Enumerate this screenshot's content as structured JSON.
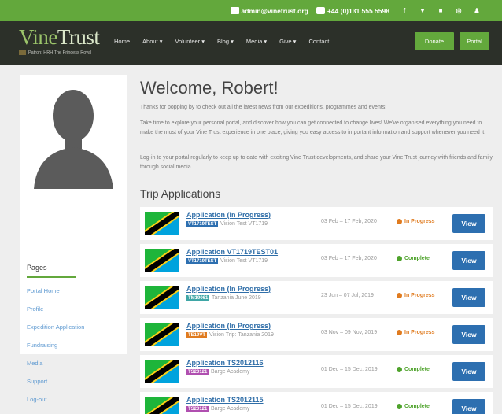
{
  "topbar": {
    "email": "admin@vinetrust.org",
    "phone": "+44 (0)131 555 5598",
    "social": [
      {
        "icon": "facebook-icon",
        "glyph": "f"
      },
      {
        "icon": "twitter-icon",
        "glyph": "▾"
      },
      {
        "icon": "youtube-icon",
        "glyph": "■"
      },
      {
        "icon": "instagram-icon",
        "glyph": "◎"
      },
      {
        "icon": "account-icon",
        "glyph": "♟"
      }
    ]
  },
  "header": {
    "logo": {
      "vine": "Vine",
      "trust": "Trust",
      "patron": "Patron: HRH The Princess Royal"
    },
    "nav": [
      "Home",
      "About ▾",
      "Volunteer ▾",
      "Blog ▾",
      "Media ▾",
      "Give ▾",
      "Contact"
    ],
    "donate_label": "Donate",
    "portal_label": "Portal"
  },
  "sidebar": {
    "heading": "Pages",
    "links": [
      "Portal Home",
      "Profile",
      "Expedition Application",
      "Fundraising",
      "Media",
      "Support",
      "Log-out"
    ]
  },
  "main": {
    "welcome": "Welcome, Robert!",
    "paragraphs": [
      "Thanks for popping by to check out all the latest news from our expeditions, programmes and events!",
      "Take time to explore your personal portal, and discover how you can get connected to change lives! We've organised everything you need to make the most of your Vine Trust experience in one place, giving you easy access to important information and support whenever you need it.",
      "Log-in to your portal regularly to keep up to date with exciting Vine Trust developments, and share your Vine Trust journey with friends and family through social media."
    ],
    "trip_heading": "Trip Applications",
    "view_label": "View",
    "applications": [
      {
        "title": "Application (In Progress)",
        "code": "VT1719TEST",
        "code_color": "#2d6fb0",
        "trip": "Vision Test VT1719",
        "dates": "03 Feb – 17 Feb, 2020",
        "status": "In Progress",
        "status_color": "#e07b1f"
      },
      {
        "title": "Application VT1719TEST01",
        "code": "VT1719TEST",
        "code_color": "#2d6fb0",
        "trip": "Vision Test VT1719",
        "dates": "03 Feb – 17 Feb, 2020",
        "status": "Complete",
        "status_color": "#4fa32c"
      },
      {
        "title": "Application (In Progress)",
        "code": "TM19061",
        "code_color": "#3fa6a6",
        "trip": "Tanzania June 2019",
        "dates": "23 Jun – 07 Jul, 2019",
        "status": "In Progress",
        "status_color": "#e07b1f"
      },
      {
        "title": "Application (In Progress)",
        "code": "TE19VT",
        "code_color": "#e07b1f",
        "trip": "Vision Trip: Tanzania 2019",
        "dates": "03 Nov – 09 Nov, 2019",
        "status": "In Progress",
        "status_color": "#e07b1f"
      },
      {
        "title": "Application TS2012116",
        "code": "TS20121",
        "code_color": "#b04fb0",
        "trip": "Barge Academy",
        "dates": "01 Dec – 15 Dec, 2019",
        "status": "Complete",
        "status_color": "#4fa32c"
      },
      {
        "title": "Application TS2012115",
        "code": "TS20121",
        "code_color": "#b04fb0",
        "trip": "Barge Academy",
        "dates": "01 Dec – 15 Dec, 2019",
        "status": "Complete",
        "status_color": "#4fa32c"
      }
    ]
  }
}
